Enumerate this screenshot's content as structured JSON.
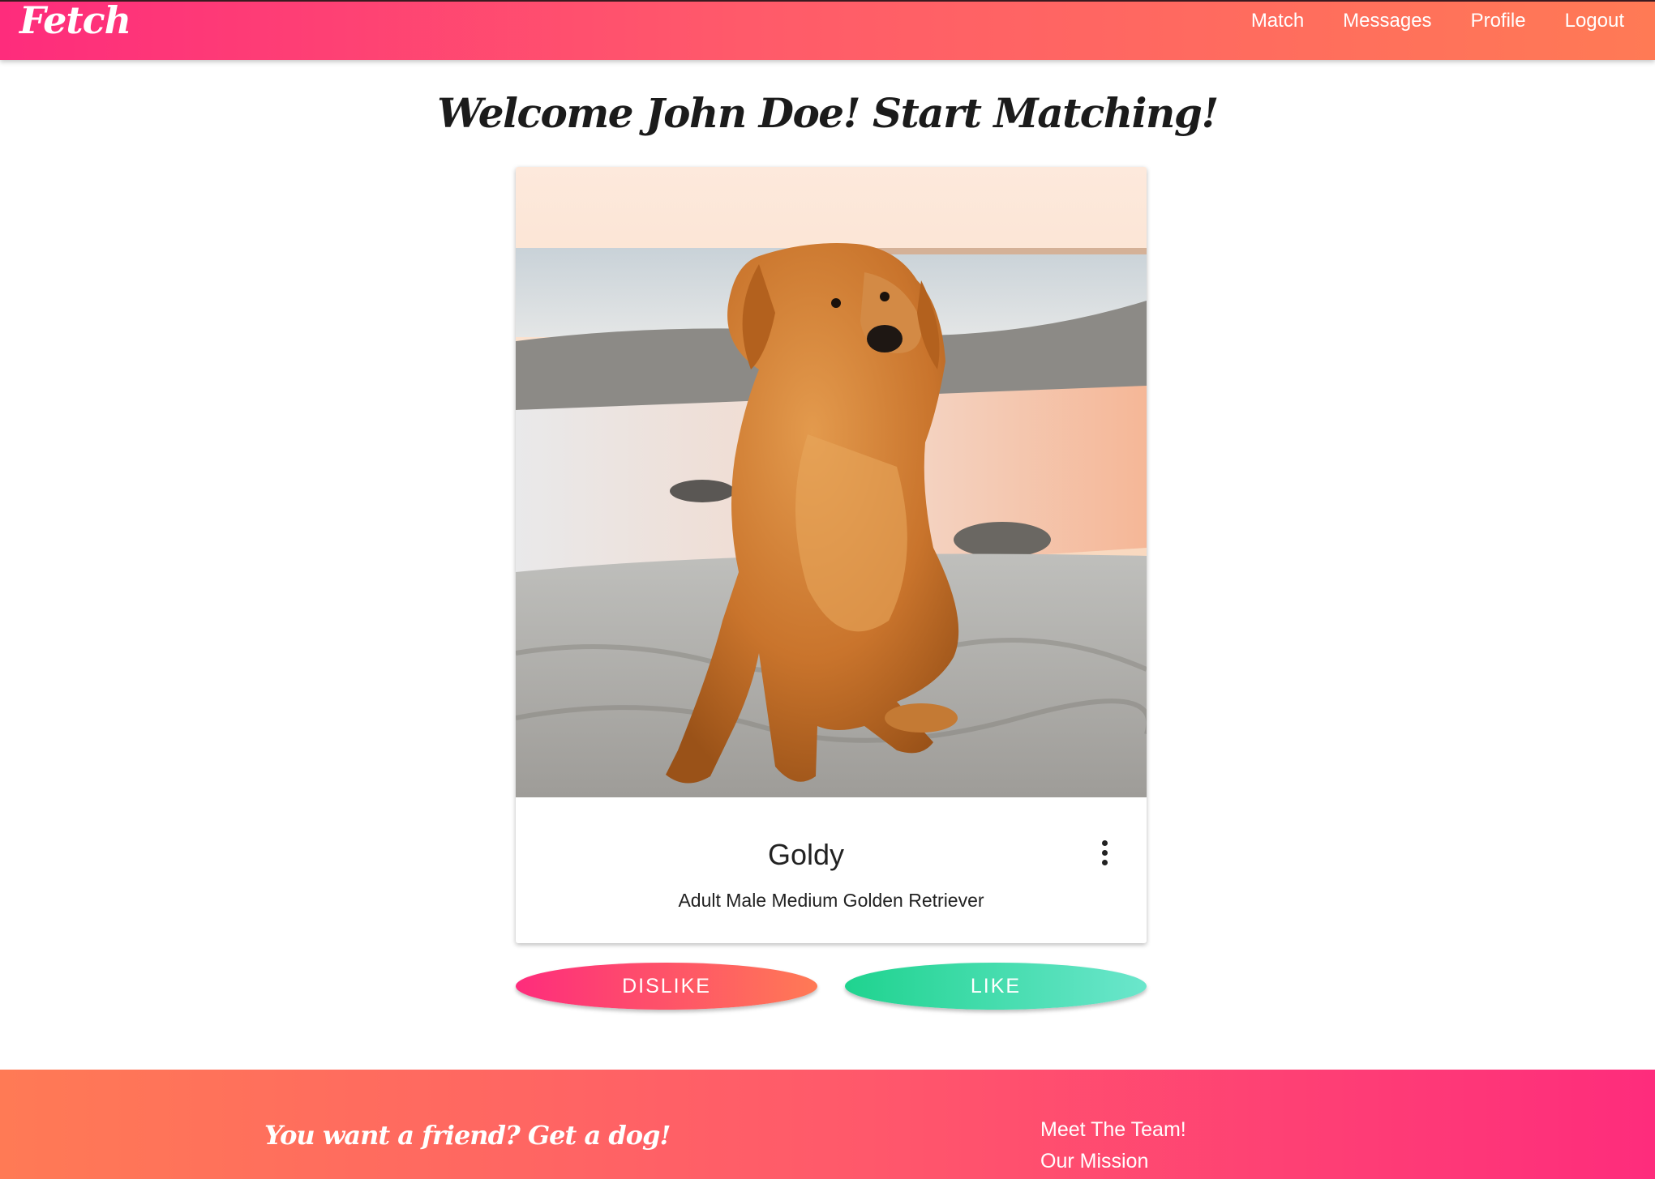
{
  "navbar": {
    "brand": "Fetch",
    "links": [
      "Match",
      "Messages",
      "Profile",
      "Logout"
    ]
  },
  "page": {
    "title": "Welcome John Doe! Start Matching!"
  },
  "card": {
    "photo_subject": "golden retriever sitting on beach sand",
    "name": "Goldy",
    "description": "Adult Male Medium Golden Retriever",
    "menu_icon": "more-vert-icon"
  },
  "actions": {
    "dislike": "DISLIKE",
    "like": "LIKE"
  },
  "footer": {
    "tagline": "You want a friend? Get a dog!",
    "links": [
      "Meet The Team!",
      "Our Mission"
    ]
  },
  "colors": {
    "brand_pink": "#fe2c7c",
    "brand_orange": "#ff7a55",
    "like_green": "#1fd38f",
    "like_teal": "#6be6cc"
  }
}
